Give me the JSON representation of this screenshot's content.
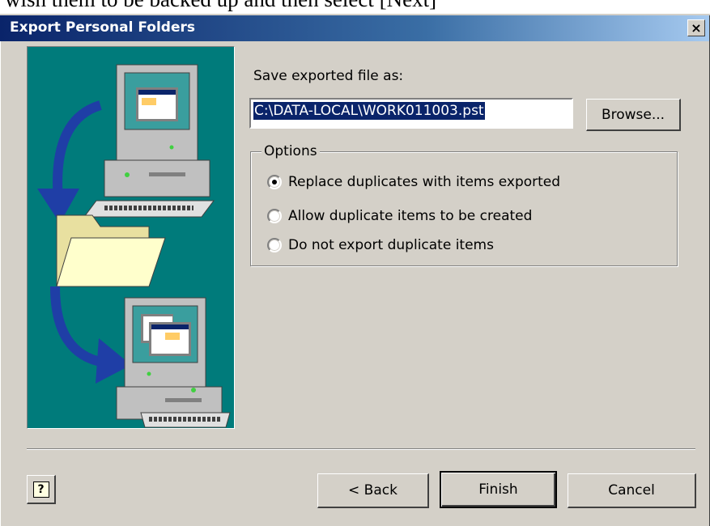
{
  "caption": "wish them to be backed up and then select [Next]",
  "dialog": {
    "title": "Export Personal Folders",
    "close_label": "×"
  },
  "save_label": "Save exported file as:",
  "file_path": "C:\\DATA-LOCAL\\WORK011003.pst",
  "browse_label": "Browse...",
  "options": {
    "legend": "Options",
    "items": [
      {
        "label": "Replace duplicates with items exported",
        "checked": true
      },
      {
        "label": "Allow duplicate items to be created",
        "checked": false
      },
      {
        "label": "Do not export duplicate items",
        "checked": false
      }
    ]
  },
  "buttons": {
    "back": "< Back",
    "finish": "Finish",
    "cancel": "Cancel"
  },
  "help_icon": "?",
  "colors": {
    "panel": "#007b7b",
    "titlebar_start": "#0a246a",
    "titlebar_end": "#a6caf0",
    "face": "#d4d0c8"
  },
  "icons": [
    "computer-icon",
    "folder-icon",
    "arrow-icon",
    "help-icon"
  ]
}
